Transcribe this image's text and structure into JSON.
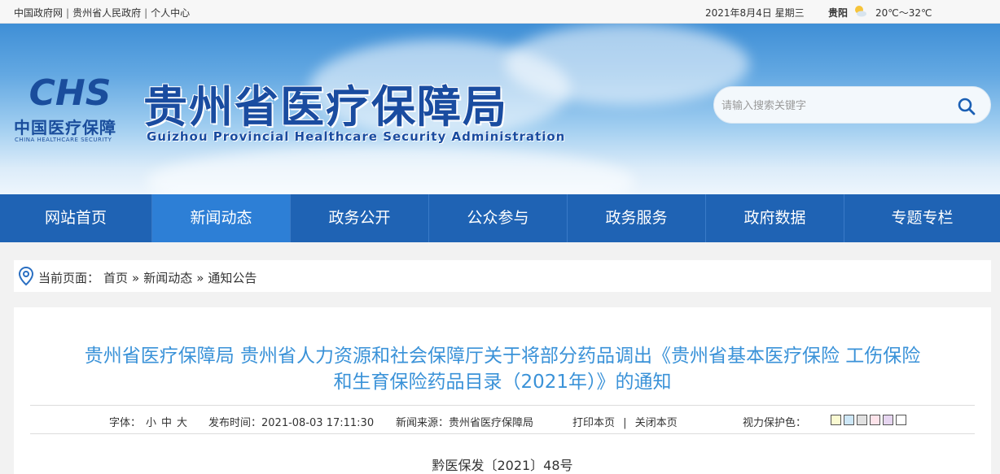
{
  "topbar": {
    "links": [
      "中国政府网",
      "贵州省人民政府",
      "个人中心"
    ],
    "separator": "|",
    "date": "2021年8月4日 星期三",
    "city": "贵阳",
    "weather_icon": "sunny-cloud-icon",
    "temperature": "20℃～32℃"
  },
  "banner": {
    "logo_mark_text": "CHS",
    "logo_cn": "中国医疗保障",
    "logo_en": "CHINA HEALTHCARE SECURITY",
    "title": "贵州省医疗保障局",
    "subtitle": "Guizhou Provincial Healthcare Security Administration",
    "search_placeholder": "请输入搜索关键字",
    "search_icon": "search-icon"
  },
  "nav": {
    "items": [
      "网站首页",
      "新闻动态",
      "政务公开",
      "公众参与",
      "政务服务",
      "政府数据",
      "专题专栏"
    ],
    "active_index": 1
  },
  "breadcrumb": {
    "label": "当前页面：",
    "items": [
      "首页",
      "新闻动态",
      "通知公告"
    ],
    "separator": "»"
  },
  "article": {
    "title_line1": "贵州省医疗保障局 贵州省人力资源和社会保障厅关于将部分药品调出《贵州省基本医疗保险 工伤保险",
    "title_line2": "和生育保险药品目录（2021年）》的通知",
    "font_label": "字体：",
    "font_sizes": [
      "小",
      "中",
      "大"
    ],
    "publish_label": "发布时间：",
    "publish_time": "2021-08-03 17:11:30",
    "source_label": "新闻来源：",
    "source": "贵州省医疗保障局",
    "print": "打印本页",
    "close": "关闭本页",
    "action_sep": "|",
    "eye_label": "视力保护色：",
    "eye_colors": [
      "#fafad2",
      "#cde7f7",
      "#e1e1e1",
      "#fde3ea",
      "#e6d5f0",
      "#ffffff"
    ],
    "doc_no": "黔医保发〔2021〕48号"
  },
  "colors": {
    "nav_bg": "#1f63b4",
    "nav_active": "#2d7fd6",
    "title_blue": "#3a92d8",
    "brand_blue": "#1a4ca0"
  }
}
